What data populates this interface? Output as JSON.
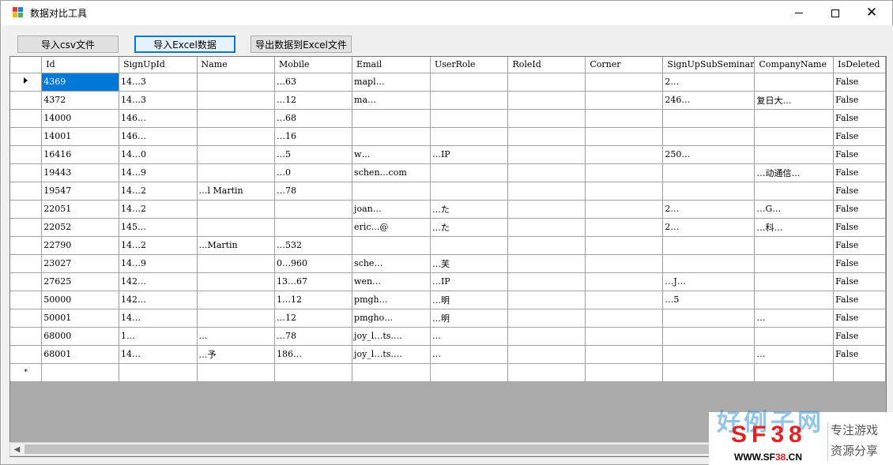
{
  "window": {
    "title": "数据对比工具",
    "controls": {
      "minimize": "─",
      "maximize": "☐",
      "close": "✕"
    }
  },
  "toolbar": {
    "import_csv": "导入csv文件",
    "import_excel": "导入Excel数据",
    "export_excel": "导出数据到Excel文件"
  },
  "grid": {
    "columns": [
      "Id",
      "SignUpId",
      "Name",
      "Mobile",
      "Email",
      "UserRole",
      "RoleId",
      "Corner",
      "SignUpSubSeminar",
      "CompanyName",
      "IsDeleted"
    ],
    "rows": [
      [
        "4369",
        "14…3",
        "",
        "…63",
        "mapl…",
        "",
        "",
        "",
        "2…",
        "",
        "False"
      ],
      [
        "4372",
        "14…3",
        "",
        "…12",
        "ma…",
        "",
        "",
        "",
        "246…",
        "复日大…",
        "False"
      ],
      [
        "14000",
        "146…",
        "",
        "…68",
        "",
        "",
        "",
        "",
        "",
        "",
        "False"
      ],
      [
        "14001",
        "146…",
        "",
        "…16",
        "",
        "",
        "",
        "",
        "",
        "",
        "False"
      ],
      [
        "16416",
        "14…0",
        "",
        "…5",
        "w…",
        "…IP",
        "",
        "",
        "250…",
        "",
        "False"
      ],
      [
        "19443",
        "14…9",
        "",
        "…0",
        "schen…com",
        "",
        "",
        "",
        "",
        "…动通信…",
        "False"
      ],
      [
        "19547",
        "14…2",
        "…l Martin",
        "…78",
        "",
        "",
        "",
        "",
        "",
        "",
        "False"
      ],
      [
        "22051",
        "14…2",
        "",
        "",
        "joan…",
        "…た",
        "",
        "",
        "2…",
        "…G…",
        "False"
      ],
      [
        "22052",
        "145…",
        "",
        "",
        "eric…@",
        "…た",
        "",
        "",
        "2…",
        "…科…",
        "False"
      ],
      [
        "22790",
        "14…2",
        "…Martin",
        "…532",
        "",
        "",
        "",
        "",
        "",
        "",
        "False"
      ],
      [
        "23027",
        "14…9",
        "",
        "0…960",
        "sche…",
        "…芙",
        "",
        "",
        "",
        "",
        "False"
      ],
      [
        "27625",
        "142…",
        "",
        "13…67",
        "wen…",
        "…IP",
        "",
        "",
        "…J…",
        "",
        "False"
      ],
      [
        "50000",
        "142…",
        "",
        "1…12",
        "pmgh…",
        "…明",
        "",
        "",
        "…5",
        "",
        "False"
      ],
      [
        "50001",
        "14…",
        "",
        "…12",
        "pmgho…",
        "…明",
        "",
        "",
        "",
        "…",
        "False"
      ],
      [
        "68000",
        "1…",
        "…",
        "…78",
        "joy_l…ts.…",
        "…",
        "",
        "",
        "",
        "",
        "False"
      ],
      [
        "68001",
        "14…",
        "…予",
        "186…",
        "joy_l…ts.…",
        "…",
        "",
        "",
        "",
        "…",
        "False"
      ]
    ],
    "new_row_marker": "*"
  },
  "watermark": {
    "logo": "SF38",
    "url_prefix": "WWW.SF",
    "url_red": "38",
    "url_suffix": ".CN",
    "tag1": "专注游戏",
    "tag2": "资源分享",
    "faded": "好例子网"
  },
  "colors": {
    "selected_cell": "#0078d7",
    "grid_background": "#ababab",
    "logo_red": "#e02424"
  }
}
